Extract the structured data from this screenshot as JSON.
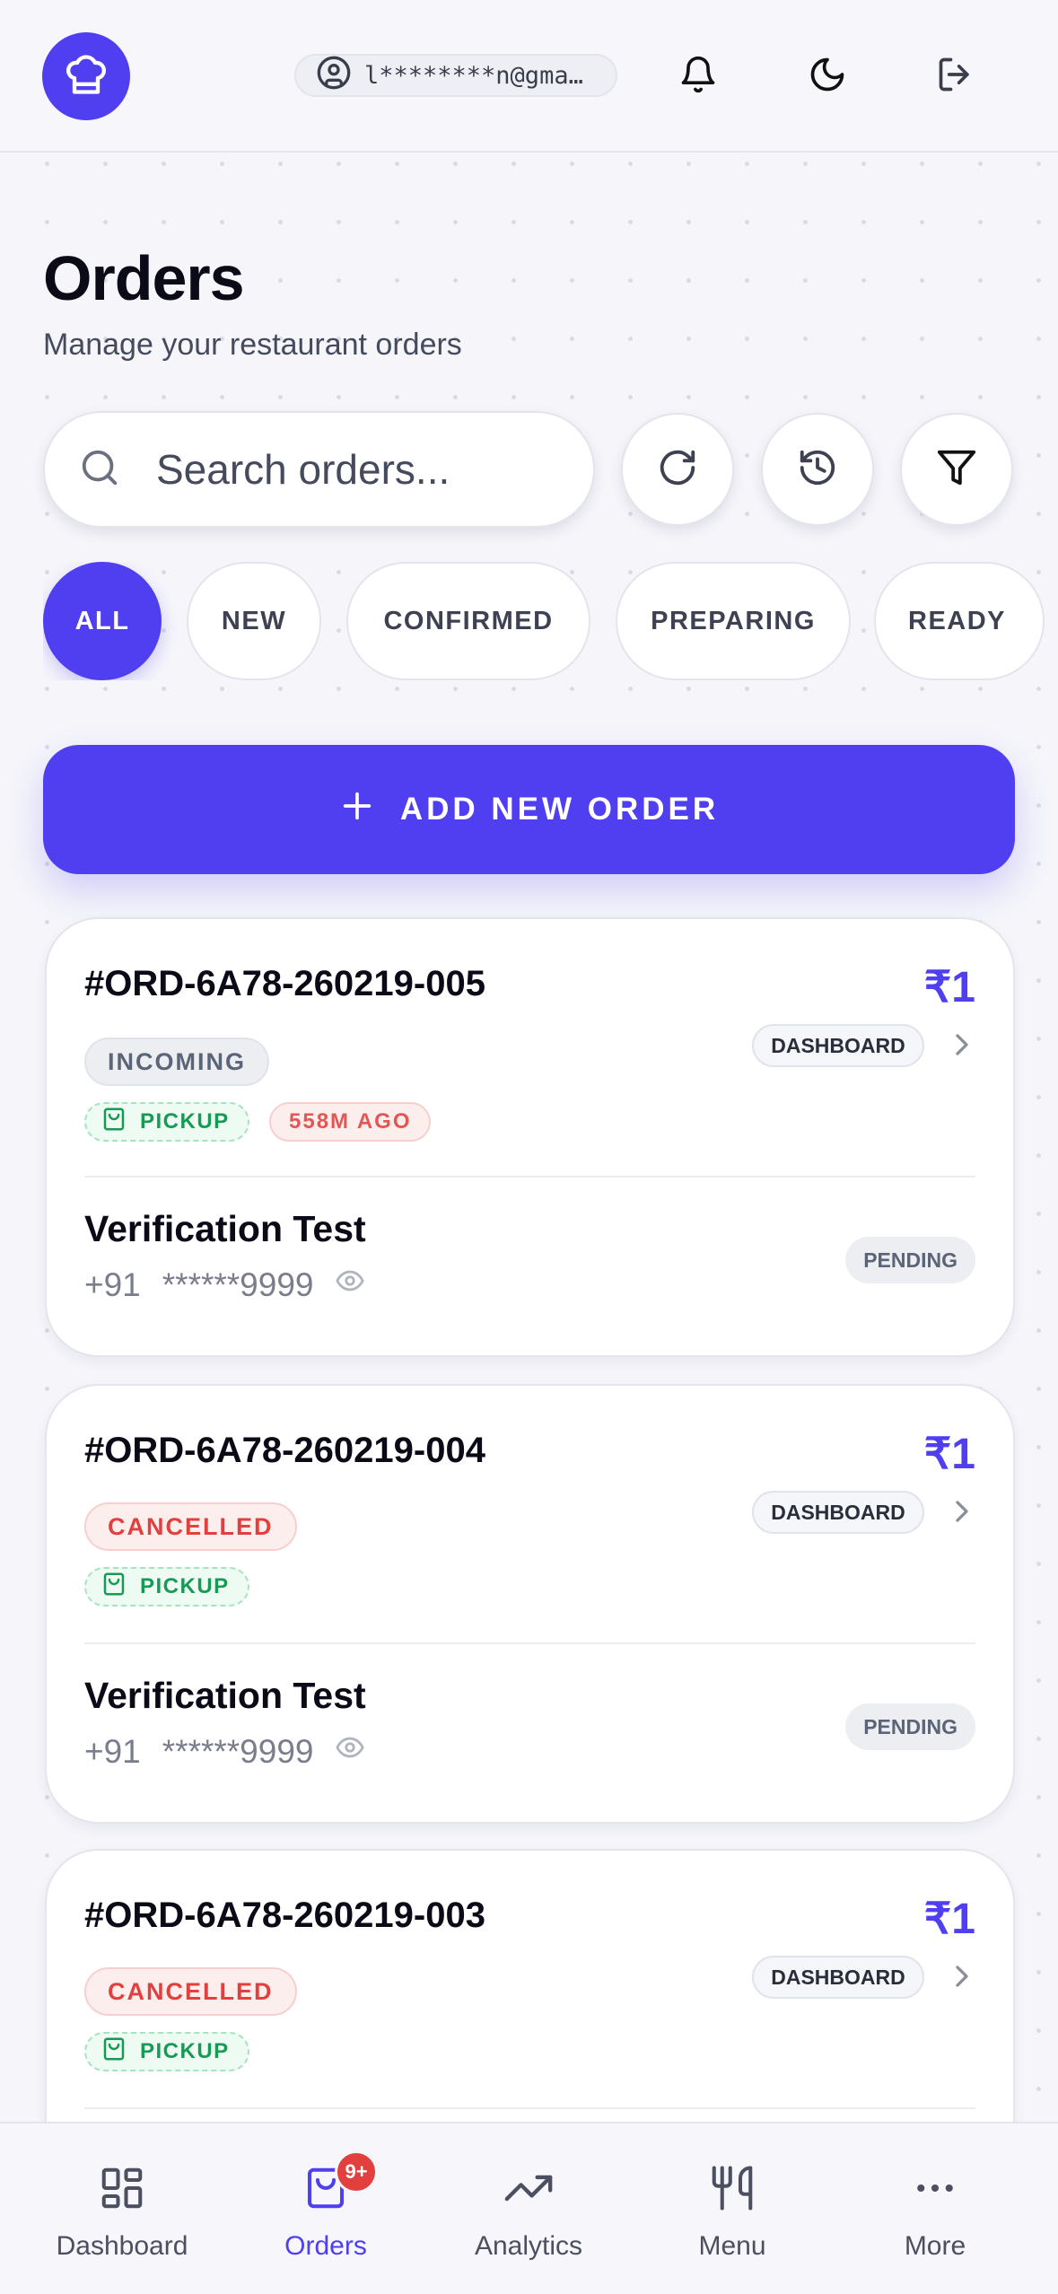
{
  "header": {
    "email": "l********n@gma…",
    "icons": [
      "chef-hat-icon",
      "user-circle-icon",
      "bell-icon",
      "moon-icon",
      "logout-icon"
    ]
  },
  "page": {
    "title": "Orders",
    "subtitle": "Manage your restaurant orders"
  },
  "search": {
    "placeholder": "Search orders..."
  },
  "filters": [
    "ALL",
    "NEW",
    "CONFIRMED",
    "PREPARING",
    "READY"
  ],
  "add_button": "ADD NEW ORDER",
  "colors": {
    "accent": "#4f3ff0",
    "cancelled": "#e2403e",
    "pickup": "#179a55"
  },
  "orders": [
    {
      "id": "#ORD-6A78-260219-005",
      "amount": "₹1",
      "status": "INCOMING",
      "type": "PICKUP",
      "ago": "558M AGO",
      "dashboard": "DASHBOARD",
      "customer": "Verification Test",
      "phone_code": "+91",
      "phone": "******9999",
      "payment": "PENDING"
    },
    {
      "id": "#ORD-6A78-260219-004",
      "amount": "₹1",
      "status": "CANCELLED",
      "type": "PICKUP",
      "dashboard": "DASHBOARD",
      "customer": "Verification Test",
      "phone_code": "+91",
      "phone": "******9999",
      "payment": "PENDING"
    },
    {
      "id": "#ORD-6A78-260219-003",
      "amount": "₹1",
      "status": "CANCELLED",
      "type": "PICKUP",
      "dashboard": "DASHBOARD"
    }
  ],
  "nav": {
    "dashboard": "Dashboard",
    "orders": "Orders",
    "orders_badge": "9+",
    "analytics": "Analytics",
    "menu": "Menu",
    "more": "More"
  }
}
